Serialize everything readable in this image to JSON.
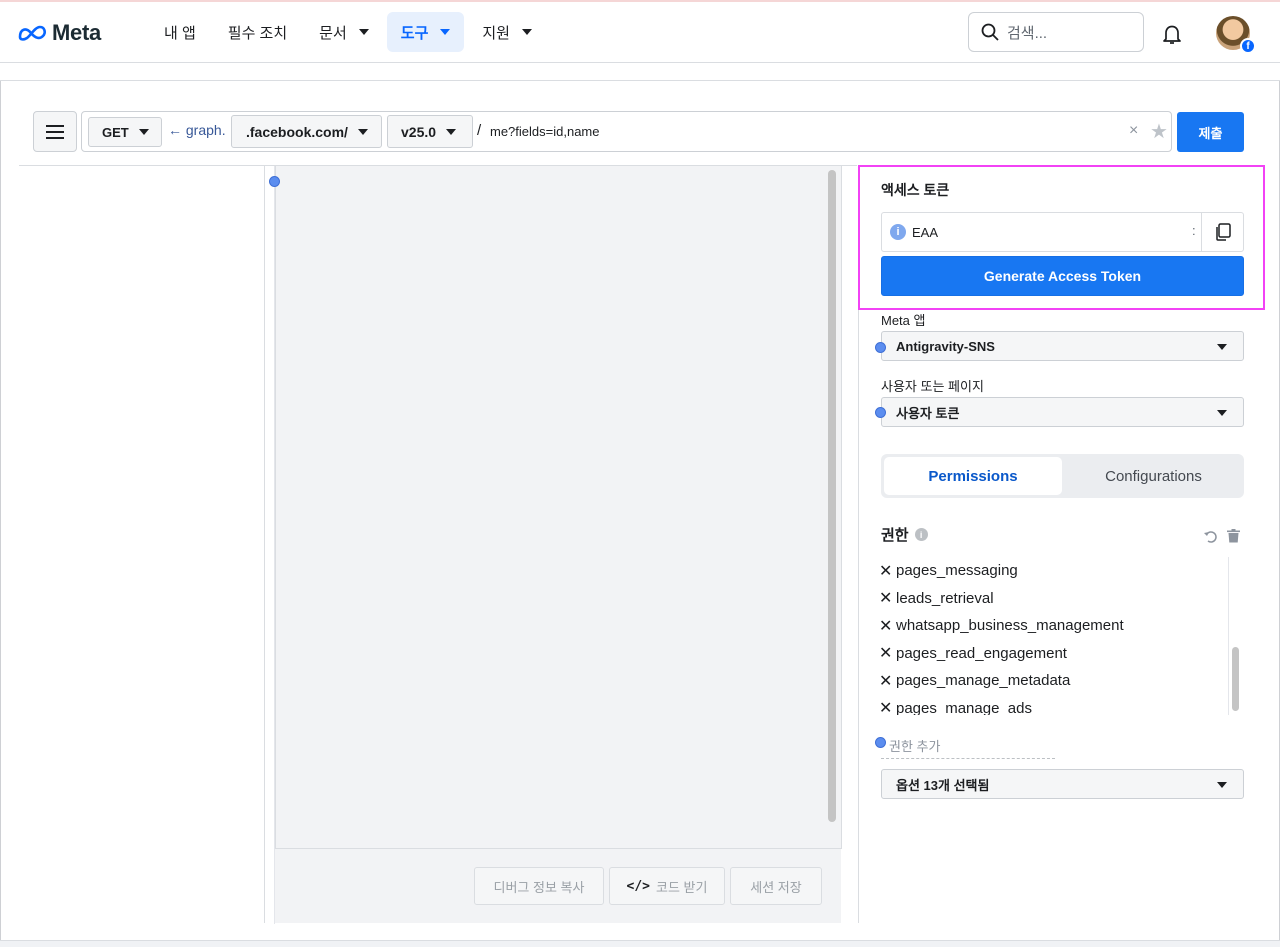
{
  "header": {
    "brand": "Meta",
    "nav": [
      {
        "label": "내 앱",
        "has_caret": false,
        "active": false
      },
      {
        "label": "필수 조치",
        "has_caret": false,
        "active": false
      },
      {
        "label": "문서",
        "has_caret": true,
        "active": false
      },
      {
        "label": "도구",
        "has_caret": true,
        "active": true
      },
      {
        "label": "지원",
        "has_caret": true,
        "active": false
      }
    ],
    "search_placeholder": "검색..."
  },
  "request": {
    "method": "GET",
    "graph_prefix": "← graph.",
    "domain": ".facebook.com/",
    "version": "v25.0",
    "slash": "/",
    "path": "me?fields=id,name",
    "clear": "×",
    "star": "★",
    "submit_label": "제출"
  },
  "footer_buttons": {
    "copy_debug": "디버그 정보 복사",
    "get_code": "코드 받기",
    "save_session": "세션 저장"
  },
  "access_token": {
    "title": "액세스 토큰",
    "value": "EAA",
    "colon": ":",
    "generate_label": "Generate Access Token"
  },
  "meta_app": {
    "label": "Meta 앱",
    "value": "Antigravity-SNS"
  },
  "user_or_page": {
    "label": "사용자 또는 페이지",
    "value": "사용자 토큰"
  },
  "tabs": {
    "permissions": "Permissions",
    "configurations": "Configurations"
  },
  "permissions": {
    "title": "권한",
    "items": [
      "pages_messaging",
      "leads_retrieval",
      "whatsapp_business_management",
      "pages_read_engagement",
      "pages_manage_metadata",
      "pages_manage_ads"
    ],
    "add_label": "권한 추가",
    "options_selected": "옵션 13개 선택됨"
  },
  "colors": {
    "primary": "#1877f2",
    "highlight": "#f242f5",
    "active_nav": "#0866ff"
  }
}
